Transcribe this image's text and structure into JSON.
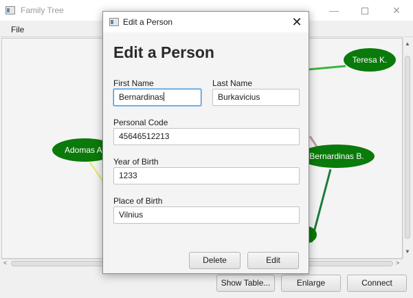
{
  "main_window": {
    "title": "Family Tree",
    "controls": {
      "minimize": "—",
      "close": "✕"
    },
    "menu": {
      "file": "File"
    },
    "graph": {
      "nodes": [
        {
          "label": "Teresa K.",
          "color": "#0a7a0a"
        },
        {
          "label": "Adomas A.",
          "color": "#0a7a0a"
        },
        {
          "label": "Bernardinas B.",
          "color": "#0a7a0a"
        },
        {
          "label": "",
          "color": "#0a7a0a"
        }
      ],
      "edge_colors": [
        "#3cb43c",
        "#e8e85a",
        "#c49aa8",
        "#1a7a3a"
      ]
    },
    "buttons": {
      "show_table": "Show Table...",
      "enlarge": "Enlarge",
      "connect": "Connect"
    }
  },
  "dialog": {
    "title": "Edit a Person",
    "close": "✕",
    "heading": "Edit a Person",
    "fields": {
      "first_name": {
        "label": "First Name",
        "value": "Bernardinas"
      },
      "last_name": {
        "label": "Last Name",
        "value": "Burkavicius"
      },
      "personal_code": {
        "label": "Personal Code",
        "value": "45646512213"
      },
      "year_of_birth": {
        "label": "Year of Birth",
        "value": "1233"
      },
      "place_of_birth": {
        "label": "Place of Birth",
        "value": "Vilnius"
      }
    },
    "buttons": {
      "delete": "Delete",
      "edit": "Edit"
    }
  }
}
